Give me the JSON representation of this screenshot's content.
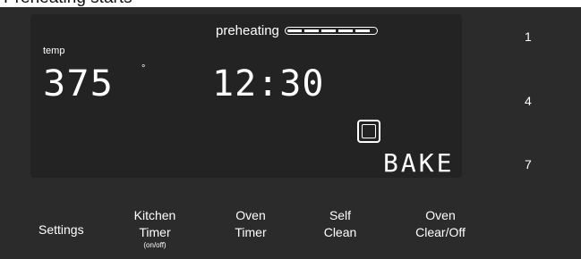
{
  "caption": "Preheating starts",
  "display": {
    "preheat_label": "preheating",
    "preheat_progress": 0.95,
    "temp_label": "temp",
    "temperature": "375",
    "temperature_unit": "°",
    "clock": "12:30",
    "mode": "BAKE"
  },
  "side_numbers": [
    "1",
    "4",
    "7"
  ],
  "buttons": {
    "settings": {
      "label": "Settings"
    },
    "kitchen_timer": {
      "line1": "Kitchen",
      "line2": "Timer",
      "sub": "(on/off)"
    },
    "oven_timer": {
      "line1": "Oven",
      "line2": "Timer"
    },
    "self_clean": {
      "line1": "Self",
      "line2": "Clean"
    },
    "oven_clear": {
      "line1": "Oven",
      "line2": "Clear/Off"
    }
  },
  "colors": {
    "panel": "#2b2b2b",
    "display": "#232323",
    "text": "#ffffff"
  },
  "icons": [
    "oven-icon",
    "preheat-progress-bar"
  ]
}
